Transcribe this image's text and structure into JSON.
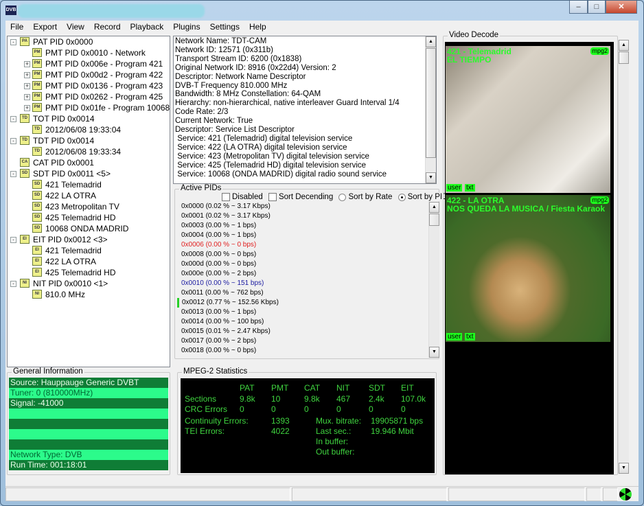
{
  "window": {
    "app_icon": "DVB",
    "controls": [
      "minimize",
      "maximize",
      "close"
    ]
  },
  "menu": [
    "File",
    "Export",
    "View",
    "Record",
    "Playback",
    "Plugins",
    "Settings",
    "Help"
  ],
  "tree": [
    {
      "level": 0,
      "expander": "-",
      "icon": "PA",
      "label": "PAT PID 0x0000"
    },
    {
      "level": 1,
      "expander": "",
      "icon": "PM",
      "label": "PMT PID 0x0010 - Network"
    },
    {
      "level": 1,
      "expander": "+",
      "icon": "PM",
      "label": "PMT PID 0x006e - Program 421"
    },
    {
      "level": 1,
      "expander": "+",
      "icon": "PM",
      "label": "PMT PID 0x00d2 - Program 422"
    },
    {
      "level": 1,
      "expander": "+",
      "icon": "PM",
      "label": "PMT PID 0x0136 - Program 423"
    },
    {
      "level": 1,
      "expander": "+",
      "icon": "PM",
      "label": "PMT PID 0x0262 - Program 425"
    },
    {
      "level": 1,
      "expander": "+",
      "icon": "PM",
      "label": "PMT PID 0x01fe - Program 10068"
    },
    {
      "level": 0,
      "expander": "-",
      "icon": "TD",
      "label": "TOT PID 0x0014"
    },
    {
      "level": 1,
      "expander": "",
      "icon": "TD",
      "label": "2012/06/08 19:33:04"
    },
    {
      "level": 0,
      "expander": "-",
      "icon": "TD",
      "label": "TDT PID 0x0014"
    },
    {
      "level": 1,
      "expander": "",
      "icon": "TD",
      "label": "2012/06/08 19:33:34"
    },
    {
      "level": 0,
      "expander": "",
      "icon": "CA",
      "label": "CAT PID 0x0001"
    },
    {
      "level": 0,
      "expander": "-",
      "icon": "SD",
      "label": "SDT PID 0x0011 <5>"
    },
    {
      "level": 1,
      "expander": "",
      "icon": "SD",
      "label": "421 Telemadrid"
    },
    {
      "level": 1,
      "expander": "",
      "icon": "SD",
      "label": "422 LA OTRA"
    },
    {
      "level": 1,
      "expander": "",
      "icon": "SD",
      "label": "423 Metropolitan TV"
    },
    {
      "level": 1,
      "expander": "",
      "icon": "SD",
      "label": "425 Telemadrid HD"
    },
    {
      "level": 1,
      "expander": "",
      "icon": "SD",
      "label": "10068 ONDA MADRID"
    },
    {
      "level": 0,
      "expander": "-",
      "icon": "EI",
      "label": "EIT PID 0x0012 <3>"
    },
    {
      "level": 1,
      "expander": "",
      "icon": "EI",
      "label": "421 Telemadrid"
    },
    {
      "level": 1,
      "expander": "",
      "icon": "EI",
      "label": "422 LA OTRA"
    },
    {
      "level": 1,
      "expander": "",
      "icon": "EI",
      "label": "425 Telemadrid HD"
    },
    {
      "level": 0,
      "expander": "-",
      "icon": "NI",
      "label": "NIT PID 0x0010 <1>"
    },
    {
      "level": 1,
      "expander": "",
      "icon": "NI",
      "label": "810.0 MHz"
    }
  ],
  "network_info": [
    "Network Name: TDT-CAM",
    "Network ID: 12571 (0x311b)",
    "Transport Stream ID: 6200 (0x1838)",
    "Original Network ID: 8916 (0x22d4) Version: 2",
    "Descriptor: Network Name Descriptor",
    "DVB-T Frequency 810.000 MHz",
    "Bandwidth: 8 MHz Constellation: 64-QAM",
    "Hierarchy: non-hierarchical, native interleaver Guard Interval 1/4",
    "Code Rate: 2/3",
    "Current Network: True",
    "Descriptor: Service List Descriptor",
    " Service: 421 (Telemadrid) digital television service",
    " Service: 422 (LA OTRA) digital television service",
    " Service: 423 (Metropolitan TV) digital television service",
    " Service: 425 (Telemadrid HD) digital television service",
    " Service: 10068 (ONDA MADRID) digital radio sound service"
  ],
  "active_pids": {
    "title": "Active PIDs",
    "options": {
      "disabled": {
        "label": "Disabled",
        "checked": false
      },
      "sort_desc": {
        "label": "Sort Decending",
        "checked": false
      },
      "sort_rate": {
        "label": "Sort by Rate",
        "selected": false
      },
      "sort_pid": {
        "label": "Sort by PID",
        "selected": true
      }
    },
    "items": [
      {
        "text": "0x0000 (0.02 % ~ 3.17 Kbps)",
        "color": "#000000"
      },
      {
        "text": "0x0001 (0.02 % ~ 3.17 Kbps)",
        "color": "#000000"
      },
      {
        "text": "0x0003 (0.00 % ~ 1 bps)",
        "color": "#000000"
      },
      {
        "text": "0x0004 (0.00 % ~ 1 bps)",
        "color": "#000000"
      },
      {
        "text": "0x0006 (0.00 % ~ 0 bps)",
        "color": "#e02020"
      },
      {
        "text": "0x0008 (0.00 % ~ 0 bps)",
        "color": "#000000"
      },
      {
        "text": "0x000d (0.00 % ~ 0 bps)",
        "color": "#000000"
      },
      {
        "text": "0x000e (0.00 % ~ 2 bps)",
        "color": "#000000"
      },
      {
        "text": "0x0010 (0.00 % ~ 151 bps)",
        "color": "#1a1aa0"
      },
      {
        "text": "0x0011 (0.00 % ~ 762 bps)",
        "color": "#000000"
      },
      {
        "text": "0x0012 (0.77 % ~ 152.56 Kbps)",
        "color": "#000000",
        "activity": true
      },
      {
        "text": "0x0013 (0.00 % ~ 1 bps)",
        "color": "#000000"
      },
      {
        "text": "0x0014 (0.00 % ~ 100 bps)",
        "color": "#000000"
      },
      {
        "text": "0x0015 (0.01 % ~ 2.47 Kbps)",
        "color": "#000000"
      },
      {
        "text": "0x0017 (0.00 % ~ 2 bps)",
        "color": "#000000"
      },
      {
        "text": "0x0018 (0.00 % ~ 0 bps)",
        "color": "#000000"
      }
    ]
  },
  "general_info": {
    "title": "General Information",
    "rows": [
      "Source: Hauppauge Generic DVBT",
      "Tuner: 0 (810000MHz)",
      "Signal: -41000",
      "",
      "",
      "",
      "",
      "Network Type: DVB",
      "Run Time: 001:18:01"
    ]
  },
  "mpeg_stats": {
    "title": "MPEG-2 Statistics",
    "columns": [
      "PAT",
      "PMT",
      "CAT",
      "NIT",
      "SDT",
      "EIT"
    ],
    "sections_label": "Sections",
    "sections": [
      "9.8k",
      "10",
      "9.8k",
      "467",
      "2.4k",
      "107.0k"
    ],
    "crc_label": "CRC Errors",
    "crc": [
      "0",
      "0",
      "0",
      "0",
      "0",
      "0"
    ],
    "continuity_label": "Continuity Errors:",
    "continuity": "1393",
    "tei_label": "TEI Errors:",
    "tei": "4022",
    "mux_label": "Mux. bitrate:",
    "mux": "19905871 bps",
    "last_label": "Last sec.:",
    "last": "19.946 Mbit",
    "in_label": "In buffer:",
    "out_label": "Out buffer:"
  },
  "video": {
    "title": "Video Decode",
    "streams": [
      {
        "line1": "421 - Telemadrid",
        "line2": "EL TIEMPO",
        "codec": "mpg2",
        "user": "user",
        "txt": "txt"
      },
      {
        "line1": "422 - LA OTRA",
        "line2": "NOS QUEDA LA MUSICA / Fiesta Karaok",
        "codec": "mpg2",
        "user": "user",
        "txt": "txt"
      }
    ]
  },
  "status_icon": "radiation-icon",
  "colors": {
    "stats_green": "#3fd43f",
    "info_dark": "#0f7d36",
    "info_light": "#2cfb8b",
    "video_overlay": "#2cfb2c"
  }
}
